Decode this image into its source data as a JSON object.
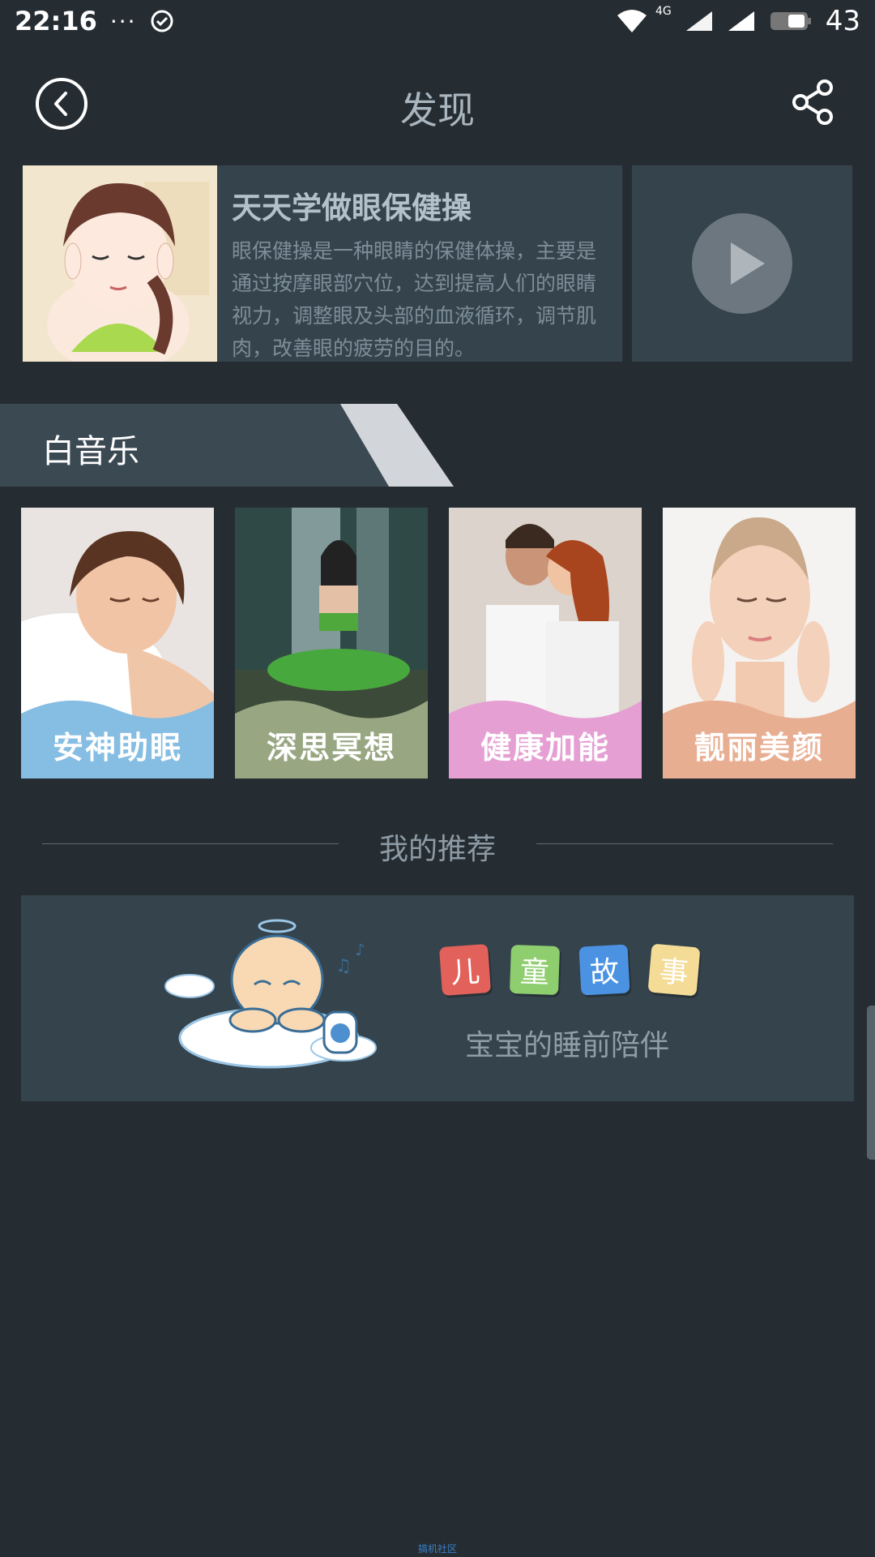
{
  "status_bar": {
    "time": "22:16",
    "dots": "···",
    "network": "4G",
    "battery": "43"
  },
  "header": {
    "title": "发现"
  },
  "feature": {
    "title": "天天学做眼保健操",
    "description": "眼保健操是一种眼睛的保健体操，主要是通过按摩眼部穴位，达到提高人们的眼睛视力，调整眼及头部的血液循环，调节肌肉，改善眼的疲劳的目的。"
  },
  "white_music": {
    "section_title": "白音乐",
    "tiles": [
      {
        "label": "安神助眠",
        "color": "#86bde3"
      },
      {
        "label": "深思冥想",
        "color": "#98a682"
      },
      {
        "label": "健康加能",
        "color": "#e59fd3"
      },
      {
        "label": "靓丽美颜",
        "color": "#e8ae92"
      }
    ]
  },
  "recommend": {
    "title": "我的推荐",
    "story": {
      "tags": [
        {
          "char": "儿",
          "color": "#e2615b"
        },
        {
          "char": "童",
          "color": "#8fce6f"
        },
        {
          "char": "故",
          "color": "#4b93e2"
        },
        {
          "char": "事",
          "color": "#f4dc97"
        }
      ],
      "subtitle": "宝宝的睡前陪伴"
    }
  },
  "footer": {
    "watermark": "搞机社区"
  }
}
